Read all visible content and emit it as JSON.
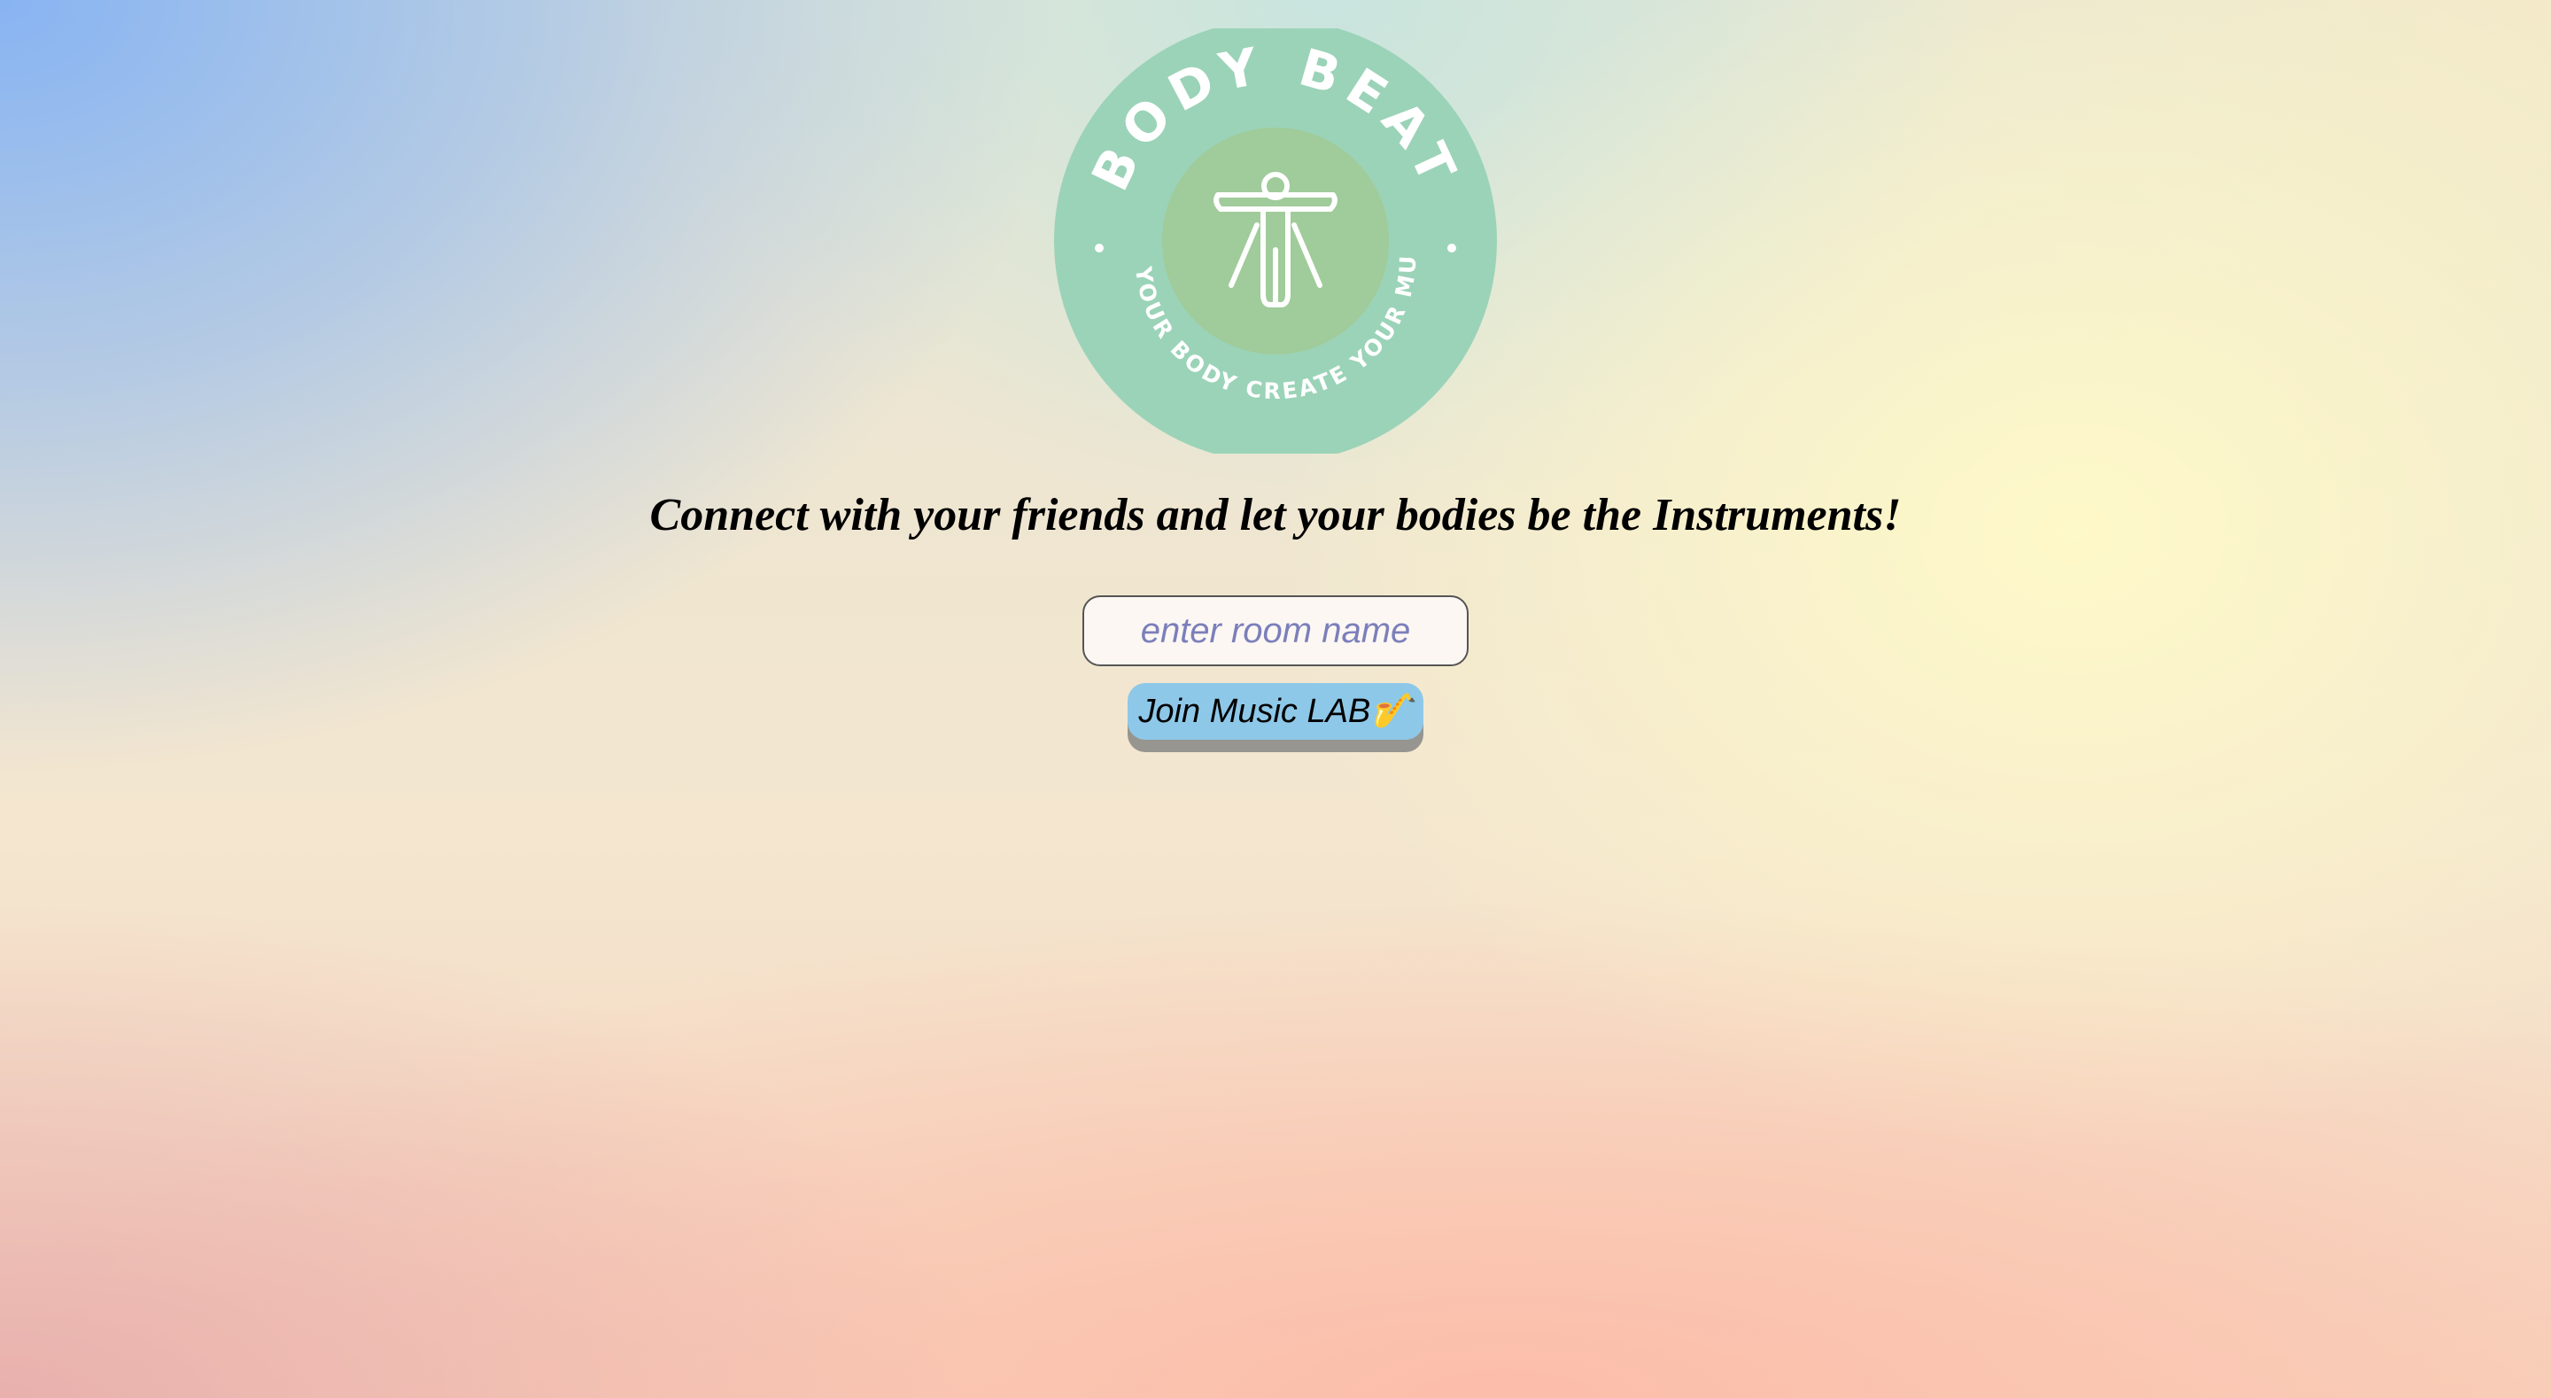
{
  "logo": {
    "title": "BODY BEAT",
    "slogan": "LET YOUR BODY CREATE YOUR MUSIC",
    "icon": "human-figure-icon",
    "colors": {
      "outer_circle": "#9bd3b8",
      "inner_circle": "#a0cb9a",
      "text": "#ffffff"
    }
  },
  "tagline": "Connect with your friends and let your bodies be the Instruments!",
  "room_input": {
    "placeholder": "enter room name",
    "value": ""
  },
  "join_button": {
    "label": "Join Music LAB🎷",
    "color": "#8ec8e8"
  }
}
